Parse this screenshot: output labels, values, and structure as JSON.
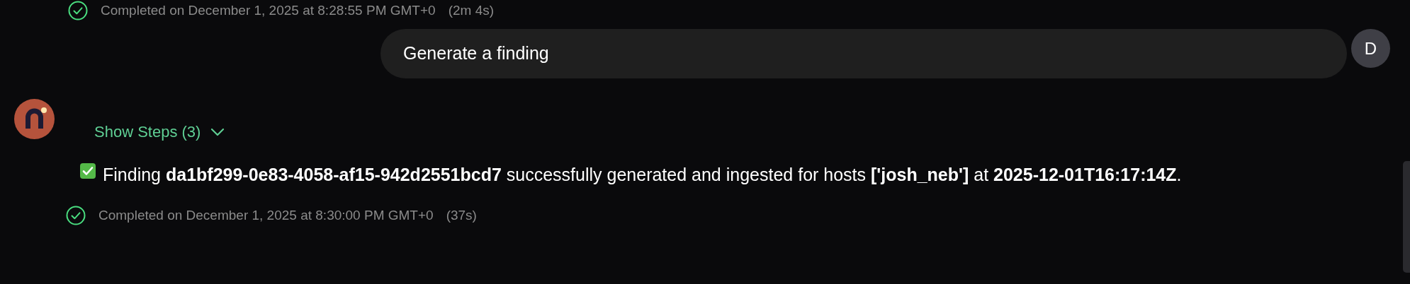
{
  "previous_status": {
    "text": "Completed on December 1, 2025 at 8:28:55 PM GMT+0",
    "duration": "(2m 4s)"
  },
  "user_message": {
    "text": "Generate a finding",
    "avatar_initial": "D"
  },
  "assistant": {
    "steps_toggle": {
      "label": "Show Steps (3)",
      "expanded": false
    },
    "message": "Finding **da1bf299-0e83-4058-af15-942d2551bcd7** successfully generated and ingested for hosts **['josh_neb']** at **2025-12-01T16:17:14Z**.",
    "status": {
      "text": "Completed on December 1, 2025 at 8:30:00 PM GMT+0",
      "duration": "(37s)"
    }
  }
}
